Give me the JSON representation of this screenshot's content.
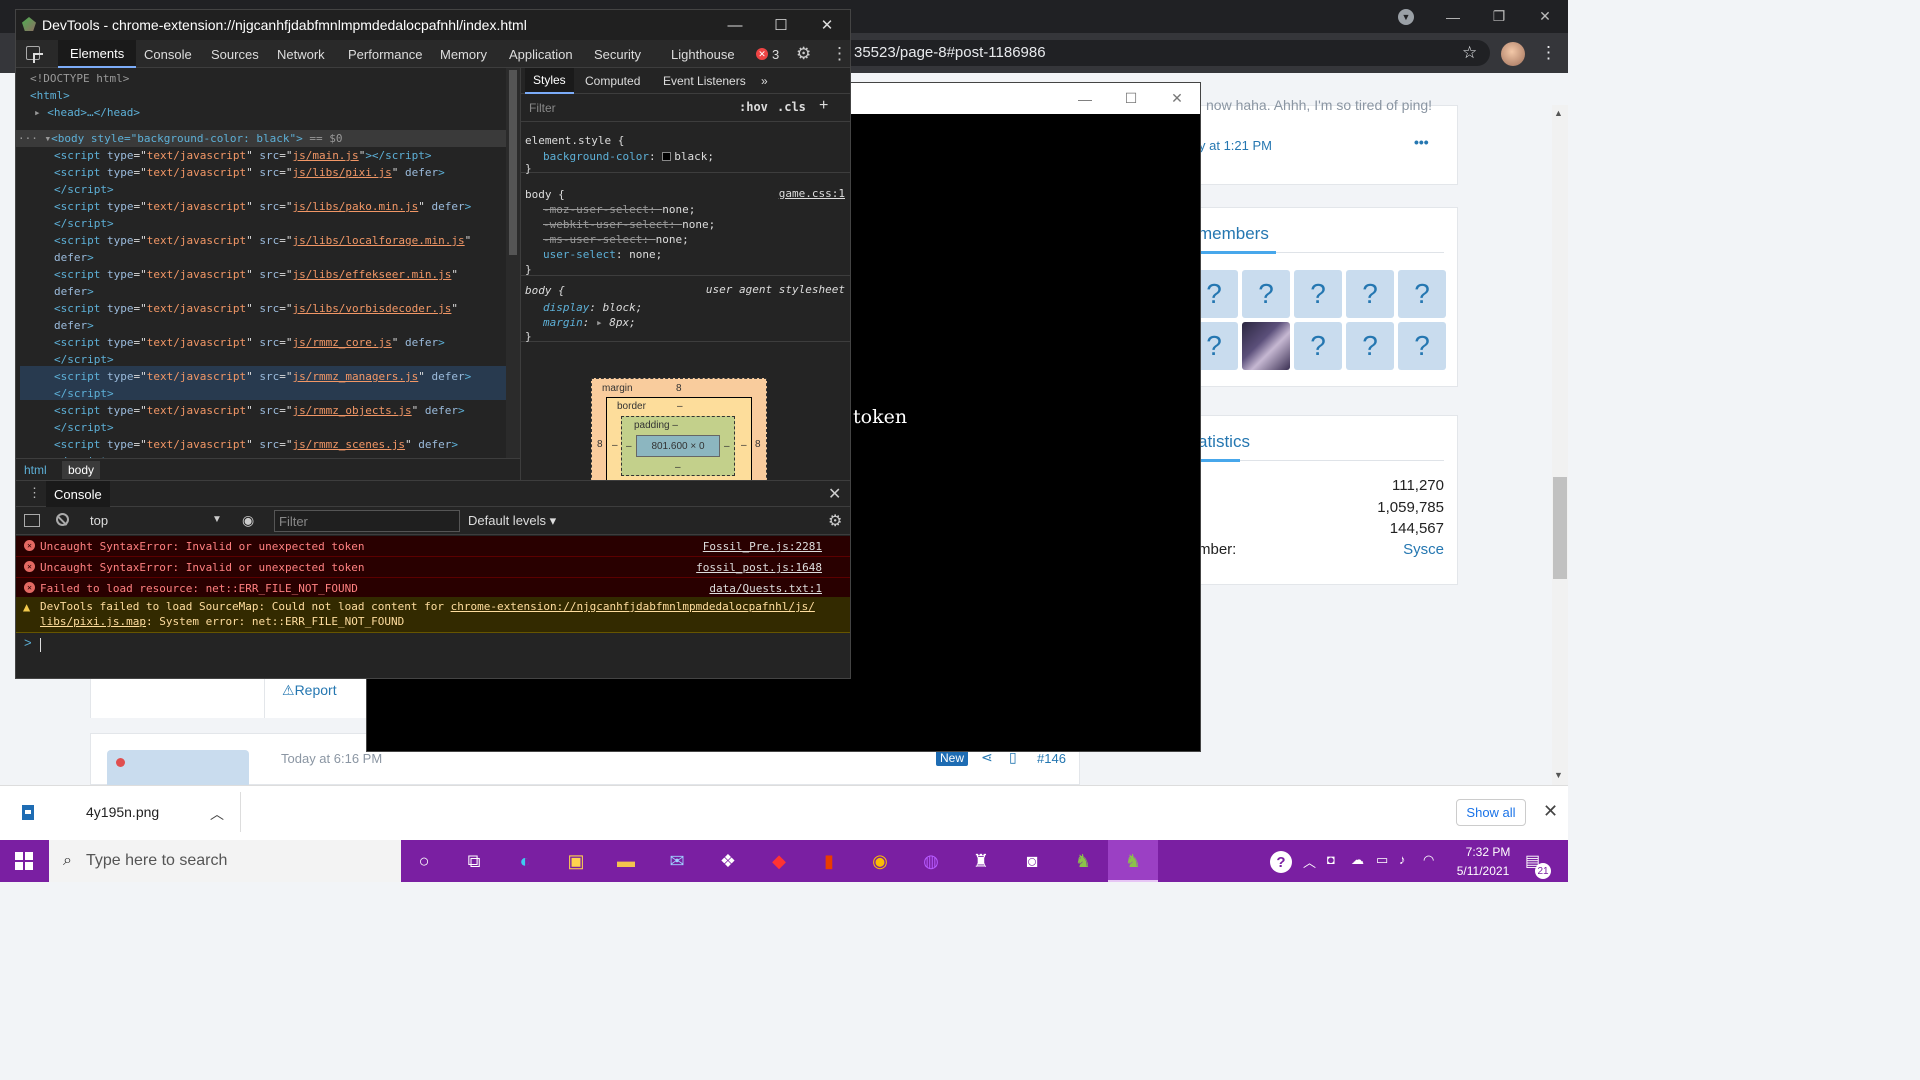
{
  "browser": {
    "address_text": "35523/page-8#post-1186986",
    "controls": {
      "minimize": "—",
      "maximize": "❐",
      "close": "✕"
    }
  },
  "page": {
    "quote_text": "now haha. Ahhh, I'm so tired of ping!",
    "post_time": "y at 1:21 PM",
    "more_dots": "•••",
    "members_title": "members",
    "member_tiles": [
      "?",
      "?",
      "?",
      "?",
      "?",
      "?",
      "",
      "?",
      "?",
      "?"
    ],
    "stats_title": "atistics",
    "stats": [
      {
        "label": "",
        "value": "111,270"
      },
      {
        "label": ":",
        "value": "1,059,785"
      },
      {
        "label": "",
        "value": "144,567"
      },
      {
        "label": "mber:",
        "value": "Sysce"
      }
    ],
    "report_label": "Report",
    "post2_time": "Today at 6:16 PM",
    "new_badge": "New",
    "post_number": "#146"
  },
  "game": {
    "text": "token"
  },
  "downloads": {
    "filename": "4y195n.png",
    "show_all": "Show all"
  },
  "taskbar": {
    "search_placeholder": "Type here to search",
    "time": "7:32 PM",
    "date": "5/11/2021",
    "notification_count": "21"
  },
  "devtools": {
    "title": "DevTools - chrome-extension://njgcanhfjdabfmnlmpmdedalocpafnhl/index.html",
    "tabs": [
      "Elements",
      "Console",
      "Sources",
      "Network",
      "Performance",
      "Memory",
      "Application",
      "Security",
      "Lighthouse"
    ],
    "error_count": "3",
    "elements": {
      "doctype": "<!DOCTYPE html>",
      "html_open": "<html>",
      "head": "<head>…</head>",
      "body_open": "<body style=\"background-color: black\">",
      "body_suffix": " == $0",
      "scripts": [
        {
          "src": "js/main.js",
          "defer": false
        },
        {
          "src": "js/libs/pixi.js",
          "defer": true
        },
        {
          "src": "js/libs/pako.min.js",
          "defer": true
        },
        {
          "src": "js/libs/localforage.min.js",
          "defer": true
        },
        {
          "src": "js/libs/effekseer.min.js",
          "defer": true
        },
        {
          "src": "js/libs/vorbisdecoder.js",
          "defer": true
        },
        {
          "src": "js/rmmz_core.js",
          "defer": true
        },
        {
          "src": "js/rmmz_managers.js",
          "defer": true
        },
        {
          "src": "js/rmmz_objects.js",
          "defer": true
        },
        {
          "src": "js/rmmz_scenes.js",
          "defer": true
        }
      ],
      "breadcrumb": [
        "html",
        "body"
      ]
    },
    "styles": {
      "tabs": [
        "Styles",
        "Computed",
        "Event Listeners"
      ],
      "more_tabs": "»",
      "filter_placeholder": "Filter",
      "hov": ":hov",
      "cls": ".cls",
      "element_style_selector": "element.style {",
      "element_style_prop": "background-color",
      "element_style_value": "black;",
      "body_rule_source": "game.css:1",
      "body_rule_props": [
        {
          "name": "-moz-user-select",
          "value": "none;",
          "struck": true
        },
        {
          "name": "-webkit-user-select",
          "value": "none;",
          "struck": true
        },
        {
          "name": "-ms-user-select",
          "value": "none;",
          "struck": true
        },
        {
          "name": "user-select",
          "value": "none;",
          "struck": false
        }
      ],
      "ua_rule_source": "user agent stylesheet",
      "ua_props": [
        {
          "name": "display",
          "value": "block;"
        },
        {
          "name": "margin",
          "value": "8px;"
        }
      ],
      "body_selector": "body {",
      "close_brace": "}",
      "box_model": {
        "margin_label": "margin",
        "margin_value": "8",
        "border_label": "border",
        "border_value": "–",
        "padding_label": "padding –",
        "content": "801.600 × 0",
        "side_value": "8",
        "dash": "–"
      }
    },
    "console": {
      "tab": "Console",
      "context": "top",
      "filter_placeholder": "Filter",
      "levels": "Default levels ▾",
      "messages": [
        {
          "type": "error",
          "text": "Uncaught SyntaxError: Invalid or unexpected token",
          "source": "Fossil_Pre.js:2281"
        },
        {
          "type": "error",
          "text": "Uncaught SyntaxError: Invalid or unexpected token",
          "source": "fossil_post.js:1648"
        },
        {
          "type": "error",
          "text": "Failed to load resource: net::ERR_FILE_NOT_FOUND",
          "source": "data/Quests.txt:1"
        }
      ],
      "warning_prefix": "DevTools failed to load SourceMap: Could not load content for ",
      "warning_link_1": "chrome-extension://njgcanhfjdabfmnlmpmdedalocpafnhl/js/",
      "warning_link_2": "libs/pixi.js.map",
      "warning_suffix": ": System error: net::ERR_FILE_NOT_FOUND",
      "prompt": ">"
    }
  },
  "colors": {
    "taskbar": "#7a1fa2",
    "link": "#2577b1",
    "devtools_bg": "#242424",
    "error_bg": "#290000",
    "warning_bg": "#332a00"
  }
}
